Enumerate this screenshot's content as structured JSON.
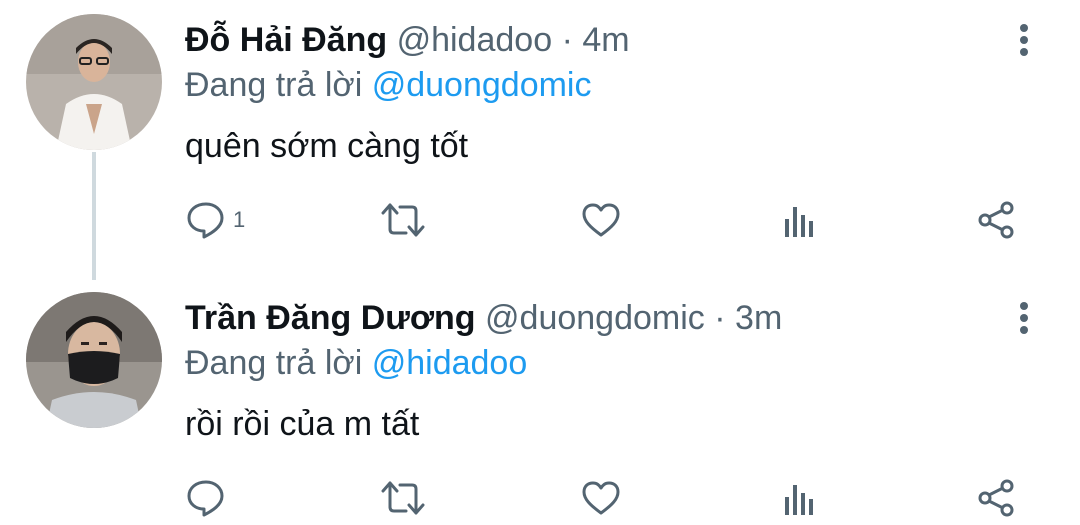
{
  "colors": {
    "text_primary": "#0f1419",
    "text_secondary": "#536471",
    "accent_link": "#1d9bf0",
    "thread_line": "#cfd9de"
  },
  "tweets": [
    {
      "name": "Đỗ Hải Đăng",
      "handle": "@hidadoo",
      "separator": "·",
      "time": "4m",
      "reply_prefix": "Đang trả lời",
      "reply_to": "@duongdomic",
      "text": "quên sớm càng tốt",
      "reply_count": "1",
      "icons": [
        "reply-icon",
        "retweet-icon",
        "like-icon",
        "views-icon",
        "share-icon",
        "more-vertical-icon"
      ]
    },
    {
      "name": "Trần Đăng Dương",
      "handle": "@duongdomic",
      "separator": "·",
      "time": "3m",
      "reply_prefix": "Đang trả lời",
      "reply_to": "@hidadoo",
      "text": "rồi rồi của m tất",
      "reply_count": "",
      "icons": [
        "reply-icon",
        "retweet-icon",
        "like-icon",
        "views-icon",
        "share-icon",
        "more-vertical-icon"
      ]
    }
  ]
}
